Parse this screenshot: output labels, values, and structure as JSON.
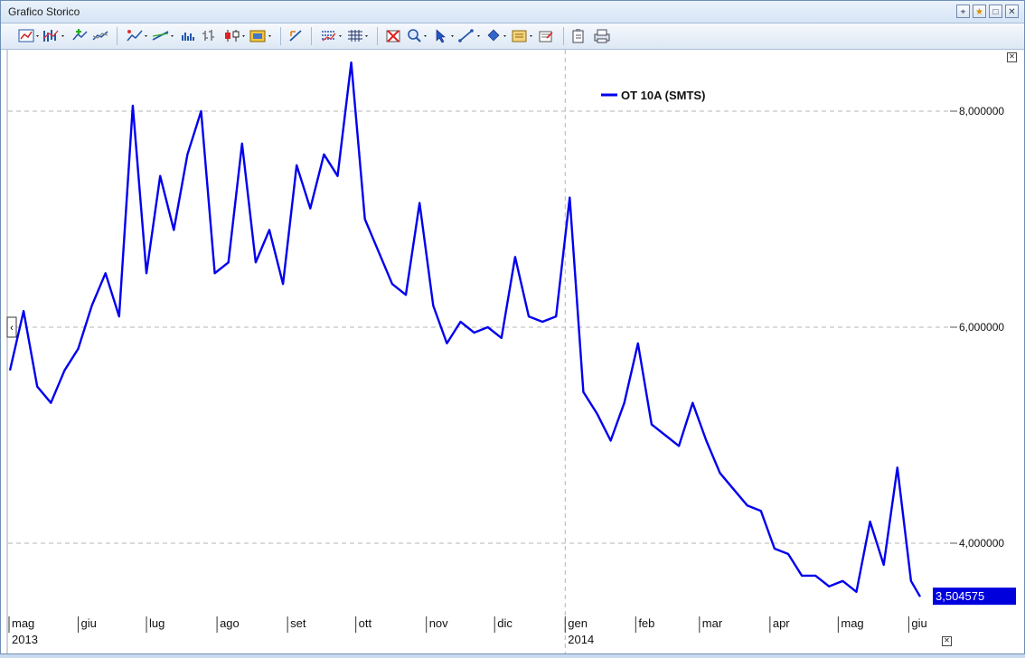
{
  "window": {
    "title": "Grafico Storico"
  },
  "window_buttons": [
    "pin-icon",
    "star-icon",
    "maximize-icon",
    "close-icon"
  ],
  "toolbar": [
    "chart-type-icon",
    "indicators-icon",
    "add-study-icon",
    "compare-icon",
    "draw-line-icon",
    "trend-icon",
    "volume-icon",
    "ohlc-icon",
    "candles-icon",
    "color-icon",
    "zoom-fit-icon",
    "bars-icon",
    "grid-icon",
    "delete-icon",
    "zoom-icon",
    "cursor-icon",
    "line-tool-icon",
    "shape-icon",
    "template-icon",
    "clear-icon",
    "copy-icon",
    "print-icon"
  ],
  "chart_data": {
    "type": "line",
    "title": "",
    "series": [
      {
        "name": "OT 10A (SMTS)",
        "color": "#0000ee",
        "x": [
          "2013-05-02",
          "2013-05-08",
          "2013-05-14",
          "2013-05-20",
          "2013-05-26",
          "2013-06-01",
          "2013-06-07",
          "2013-06-13",
          "2013-06-19",
          "2013-06-25",
          "2013-07-01",
          "2013-07-07",
          "2013-07-13",
          "2013-07-19",
          "2013-07-25",
          "2013-07-31",
          "2013-08-06",
          "2013-08-12",
          "2013-08-18",
          "2013-08-24",
          "2013-08-30",
          "2013-09-05",
          "2013-09-11",
          "2013-09-17",
          "2013-09-23",
          "2013-09-29",
          "2013-10-05",
          "2013-10-11",
          "2013-10-17",
          "2013-10-23",
          "2013-10-29",
          "2013-11-04",
          "2013-11-10",
          "2013-11-16",
          "2013-11-22",
          "2013-11-28",
          "2013-12-04",
          "2013-12-10",
          "2013-12-16",
          "2013-12-22",
          "2013-12-28",
          "2014-01-03",
          "2014-01-09",
          "2014-01-15",
          "2014-01-21",
          "2014-01-27",
          "2014-02-02",
          "2014-02-08",
          "2014-02-14",
          "2014-02-20",
          "2014-02-26",
          "2014-03-04",
          "2014-03-10",
          "2014-03-16",
          "2014-03-22",
          "2014-03-28",
          "2014-04-03",
          "2014-04-09",
          "2014-04-15",
          "2014-04-21",
          "2014-04-27",
          "2014-05-03",
          "2014-05-09",
          "2014-05-15",
          "2014-05-21",
          "2014-05-27",
          "2014-06-02",
          "2014-06-06"
        ],
        "values": [
          5.6,
          6.15,
          5.45,
          5.3,
          5.6,
          5.8,
          6.2,
          6.5,
          6.1,
          8.05,
          6.5,
          7.4,
          6.9,
          7.6,
          8.0,
          6.5,
          6.6,
          7.7,
          6.6,
          6.9,
          6.4,
          7.5,
          7.1,
          7.6,
          7.4,
          8.45,
          7.0,
          6.7,
          6.4,
          6.3,
          7.15,
          6.2,
          5.85,
          6.05,
          5.95,
          6.0,
          5.9,
          6.65,
          6.1,
          6.05,
          6.1,
          7.2,
          5.4,
          5.2,
          4.95,
          5.3,
          5.85,
          5.1,
          5.0,
          4.9,
          5.3,
          4.95,
          4.65,
          4.5,
          4.35,
          4.3,
          3.95,
          3.9,
          3.7,
          3.7,
          3.6,
          3.65,
          3.55,
          4.2,
          3.8,
          4.7,
          3.65,
          3.505
        ]
      }
    ],
    "ylim": [
      3.3,
      8.6
    ],
    "yticks": [
      4,
      6,
      8
    ],
    "ytick_labels": [
      "4,000000",
      "6,000000",
      "8,000000"
    ],
    "months": [
      "mag",
      "giu",
      "lug",
      "ago",
      "set",
      "ott",
      "nov",
      "dic",
      "gen",
      "feb",
      "mar",
      "apr",
      "mag",
      "giu"
    ],
    "years": [
      "2013",
      "2014"
    ],
    "last_value_label": "3,504575",
    "grid": true,
    "legend": "top-center"
  }
}
